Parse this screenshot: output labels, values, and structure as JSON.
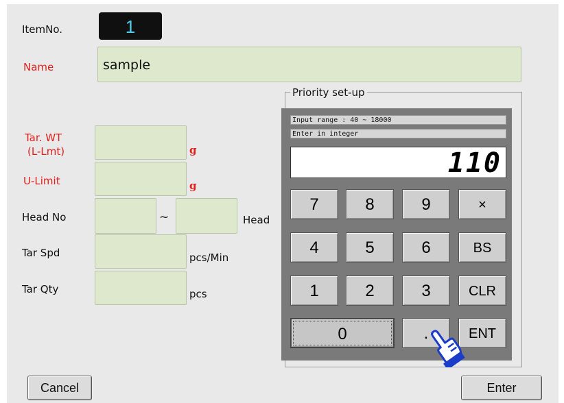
{
  "form": {
    "item_no_label": "ItemNo.",
    "item_no_value": "1",
    "name_label": "Name",
    "name_value": "sample",
    "tar_wt_label_1": "Tar. WT",
    "tar_wt_label_2": "(L-Lmt)",
    "tar_wt_unit": "g",
    "u_limit_label": "U-Limit",
    "u_limit_unit": "g",
    "head_no_label": "Head No",
    "head_no_sep": "~",
    "head_no_unit": "Head",
    "tar_spd_label": "Tar Spd",
    "tar_spd_unit": "pcs/Min",
    "tar_qty_label": "Tar Qty",
    "tar_qty_unit": "pcs"
  },
  "priority": {
    "title": "Priority set-up",
    "input_range": "Input range : 40 ~ 18000",
    "hint": "Enter in integer",
    "display_value": "110",
    "keys": {
      "k7": "7",
      "k8": "8",
      "k9": "9",
      "kx": "×",
      "k4": "4",
      "k5": "5",
      "k6": "6",
      "kbs": "BS",
      "k1": "1",
      "k2": "2",
      "k3": "3",
      "kclr": "CLR",
      "k0": "0",
      "kdot": ".",
      "kent": "ENT"
    }
  },
  "footer": {
    "cancel_label": "Cancel",
    "enter_label": "Enter"
  },
  "colors": {
    "field_bg": "#dde8cc",
    "red_label": "#e0201a",
    "item_digit": "#4fd0f0",
    "pointer_blue": "#1a3cc8"
  },
  "icons": {
    "pointer": "hand-pointer-icon"
  }
}
